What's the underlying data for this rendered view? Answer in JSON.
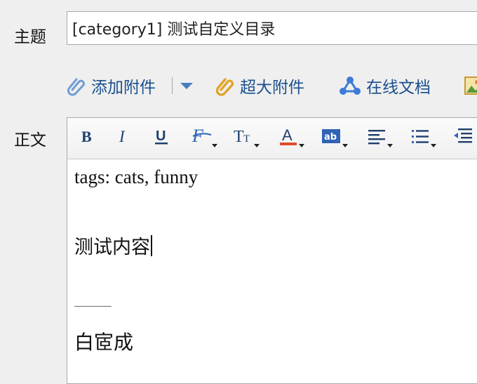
{
  "subject": {
    "label": "主题",
    "value": "[category1] 测试自定义目录"
  },
  "attach_bar": {
    "add_attachment": "添加附件",
    "separator": "|",
    "large_attachment": "超大附件",
    "online_doc": "在线文档"
  },
  "body": {
    "label": "正文",
    "toolbar_icons": [
      "bold-icon",
      "italic-icon",
      "underline-icon",
      "font-family-icon",
      "font-size-icon",
      "font-color-icon",
      "background-color-icon",
      "align-icon",
      "bullet-list-icon",
      "indent-icon"
    ],
    "lines": {
      "tags": "tags: cats, funny",
      "content": "测试内容",
      "separator": "——————",
      "signature": "白宧成"
    }
  },
  "colors": {
    "link_blue": "#1a4f8f",
    "font_color_red": "#e04b2c",
    "toolbar_blue": "#2f63b5"
  }
}
